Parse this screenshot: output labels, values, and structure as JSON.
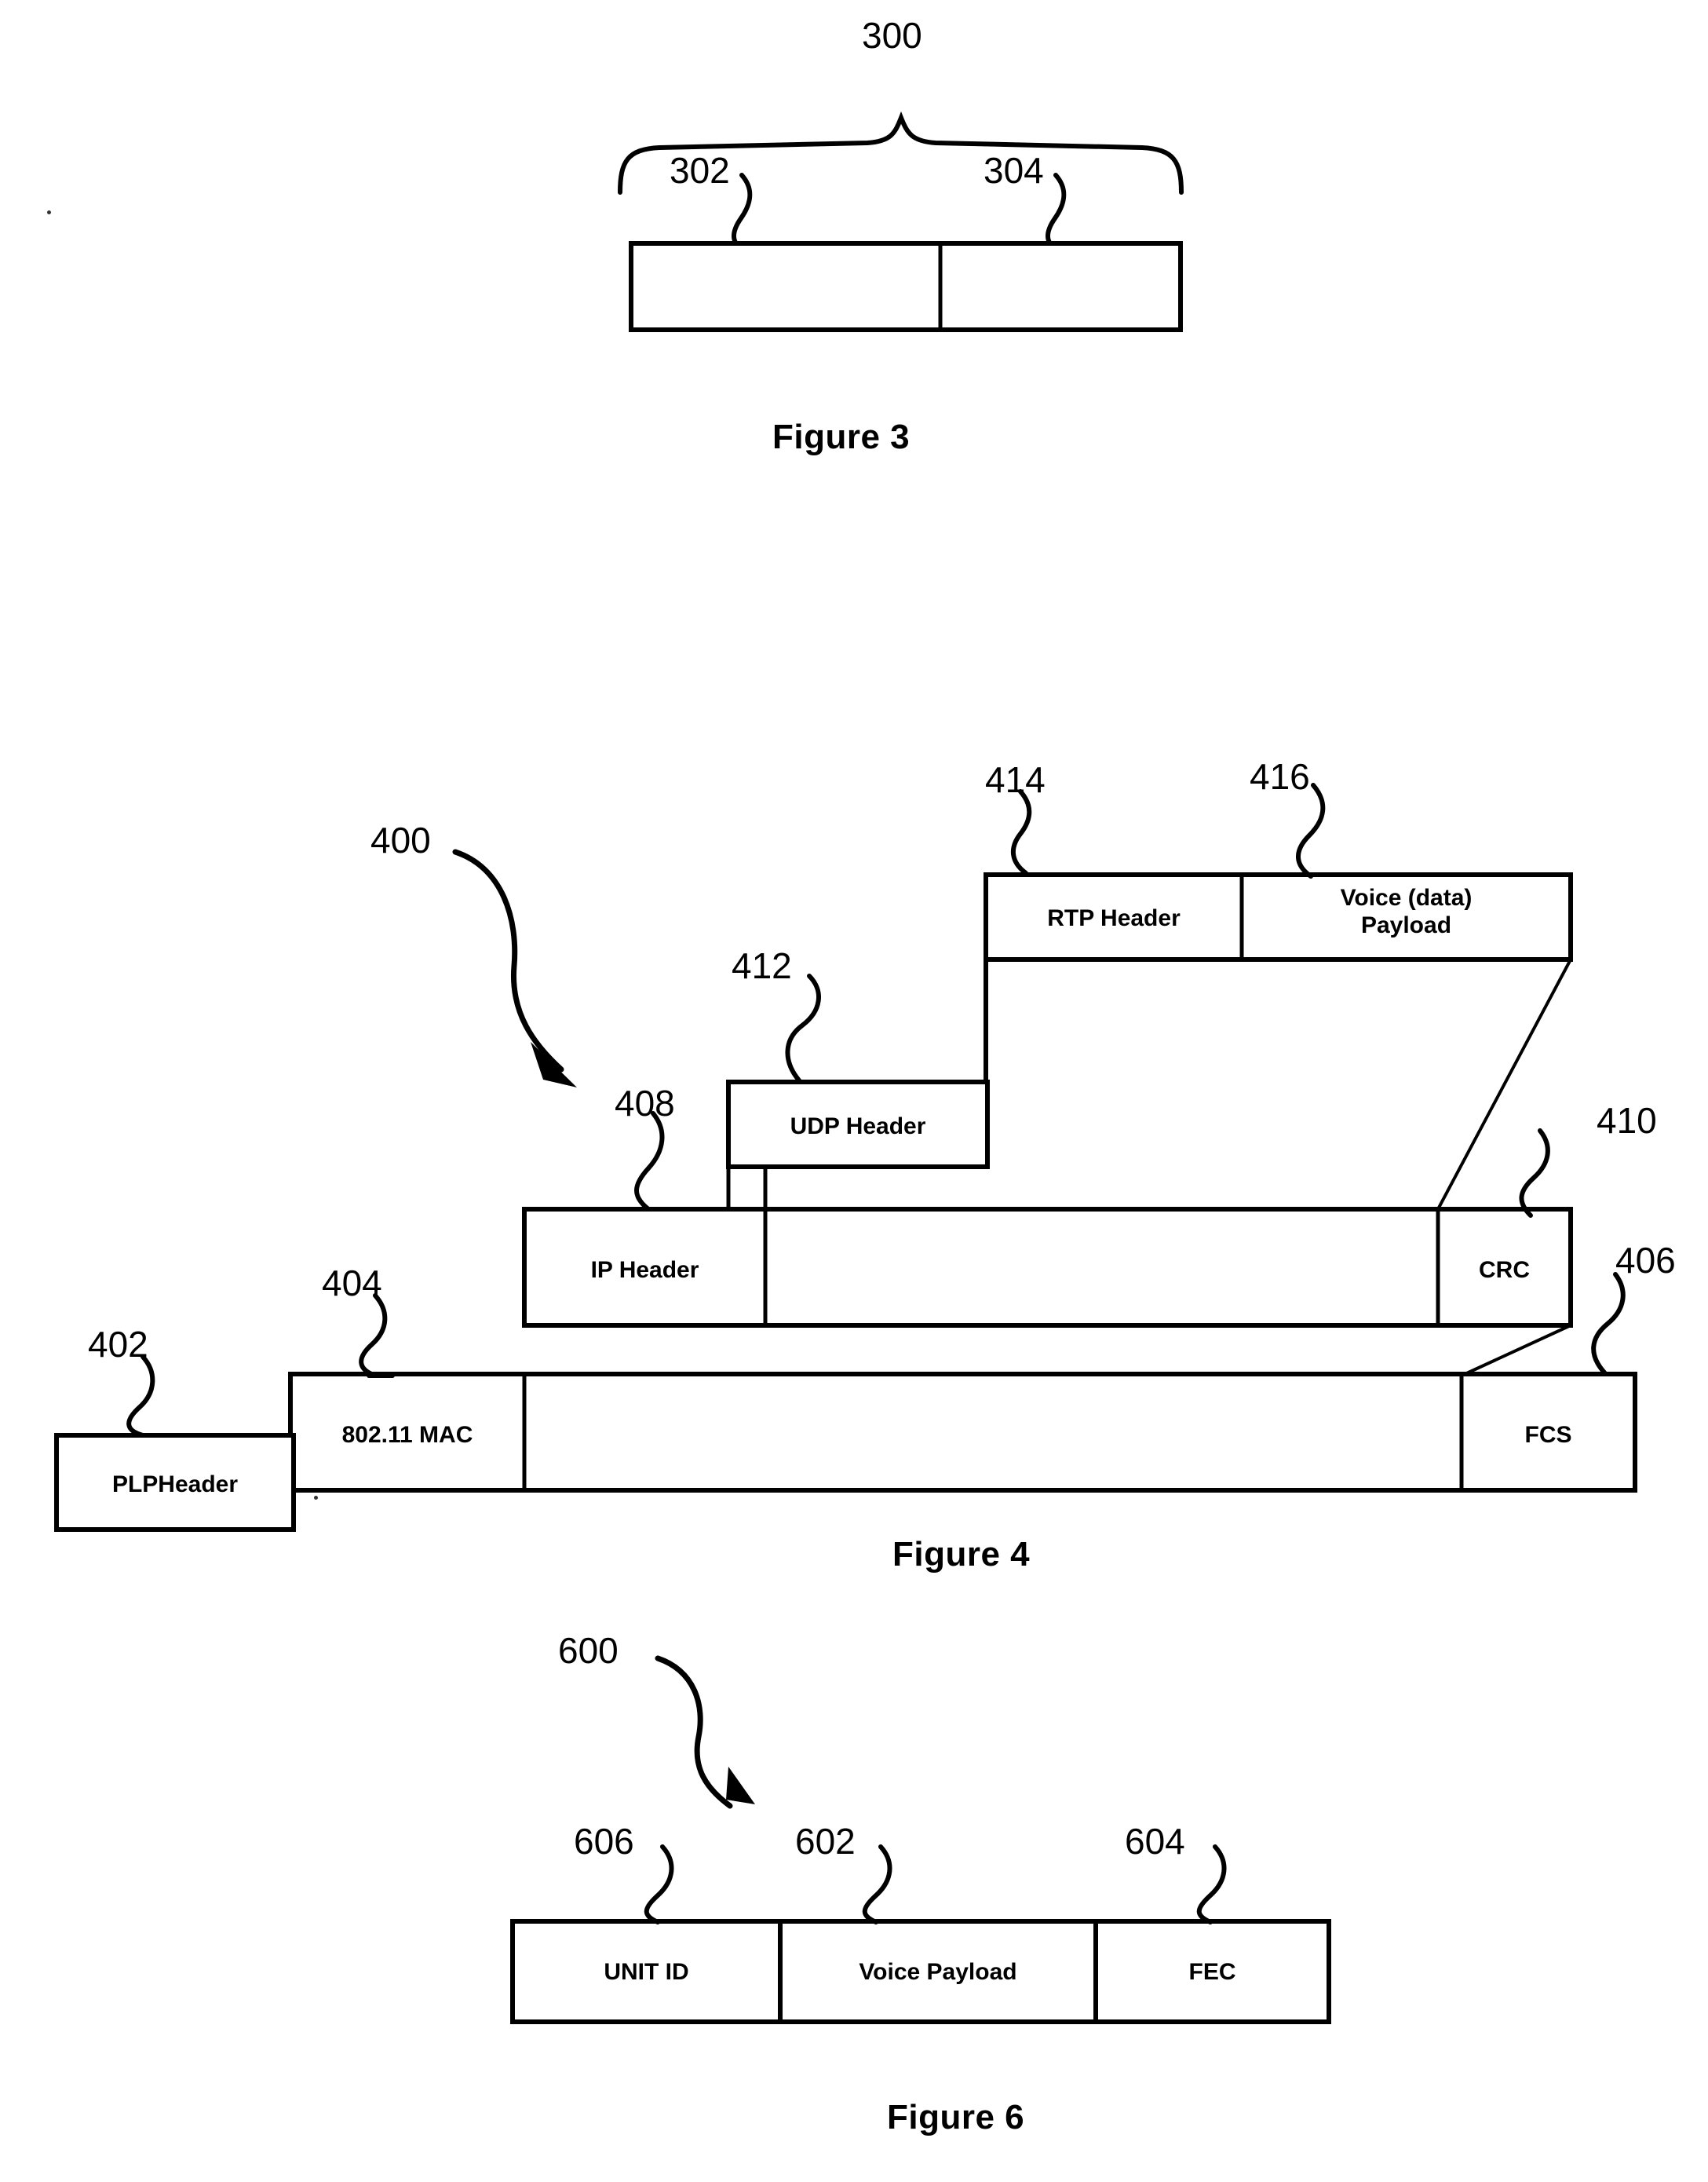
{
  "document": {
    "kind": "patent-drawing-sheet",
    "figures": [
      "Figure 3",
      "Figure 4",
      "Figure 6"
    ]
  },
  "figure3": {
    "caption": "Figure 3",
    "brace_ref": "300",
    "segments": [
      {
        "ref": "302",
        "label": ""
      },
      {
        "ref": "304",
        "label": ""
      }
    ]
  },
  "figure4": {
    "caption": "Figure 4",
    "overall_ref": "400",
    "rows": [
      {
        "name": "rtp-row",
        "cells": [
          {
            "ref": "414",
            "label": "RTP Header"
          },
          {
            "ref": "416",
            "label": "Voice (data) Payload",
            "line1": "Voice (data)",
            "line2": "Payload"
          }
        ]
      },
      {
        "name": "udp-row",
        "cells": [
          {
            "ref": "412",
            "label": "UDP Header"
          }
        ]
      },
      {
        "name": "ip-row",
        "cells": [
          {
            "ref": "408",
            "label": "IP Header"
          },
          {
            "ref": "410",
            "label": "CRC"
          }
        ]
      },
      {
        "name": "mac-row",
        "cells": [
          {
            "ref": "404",
            "label": "802.11 MAC"
          },
          {
            "ref": "406",
            "label": "FCS"
          }
        ]
      },
      {
        "name": "plp-row",
        "cells": [
          {
            "ref": "402",
            "label": "PLPHeader"
          }
        ]
      }
    ]
  },
  "figure6": {
    "caption": "Figure 6",
    "overall_ref": "600",
    "cells": [
      {
        "ref": "606",
        "label": "UNIT ID"
      },
      {
        "ref": "602",
        "label": "Voice Payload"
      },
      {
        "ref": "604",
        "label": "FEC"
      }
    ]
  },
  "style": {
    "ink": "#000000",
    "paper": "#ffffff"
  }
}
